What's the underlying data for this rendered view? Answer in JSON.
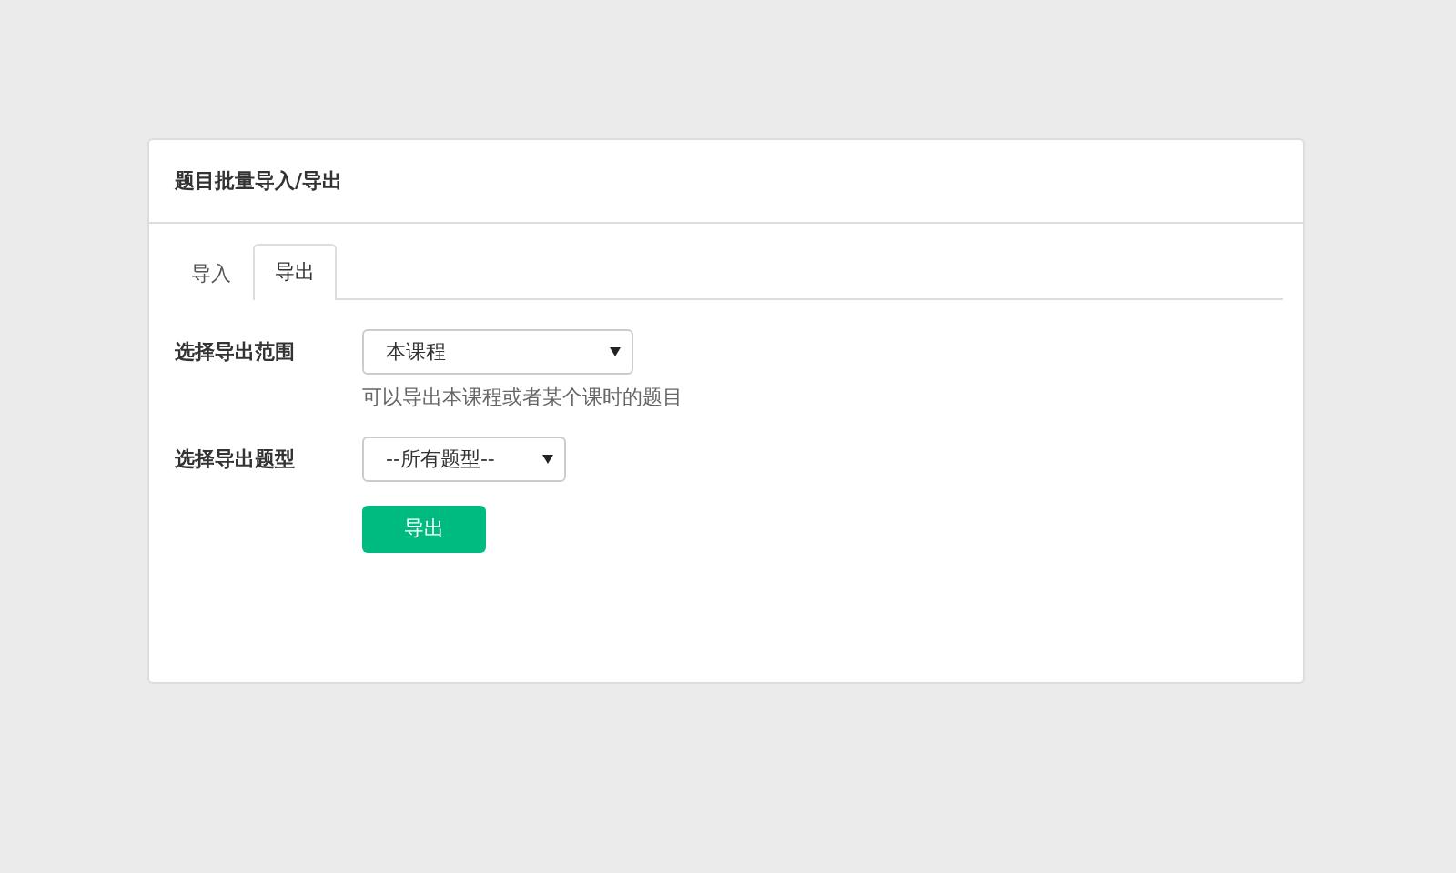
{
  "panel": {
    "title": "题目批量导入/导出"
  },
  "tabs": [
    {
      "label": "导入",
      "selected": false
    },
    {
      "label": "导出",
      "selected": true
    }
  ],
  "form": {
    "fields": [
      {
        "label": "选择导出范围",
        "value": "本课程",
        "hint": "可以导出本课程或者某个课时的题目",
        "kind": "wide"
      },
      {
        "label": "选择导出题型",
        "value": "--所有题型--",
        "kind": "narrow"
      }
    ],
    "button": "导出"
  }
}
